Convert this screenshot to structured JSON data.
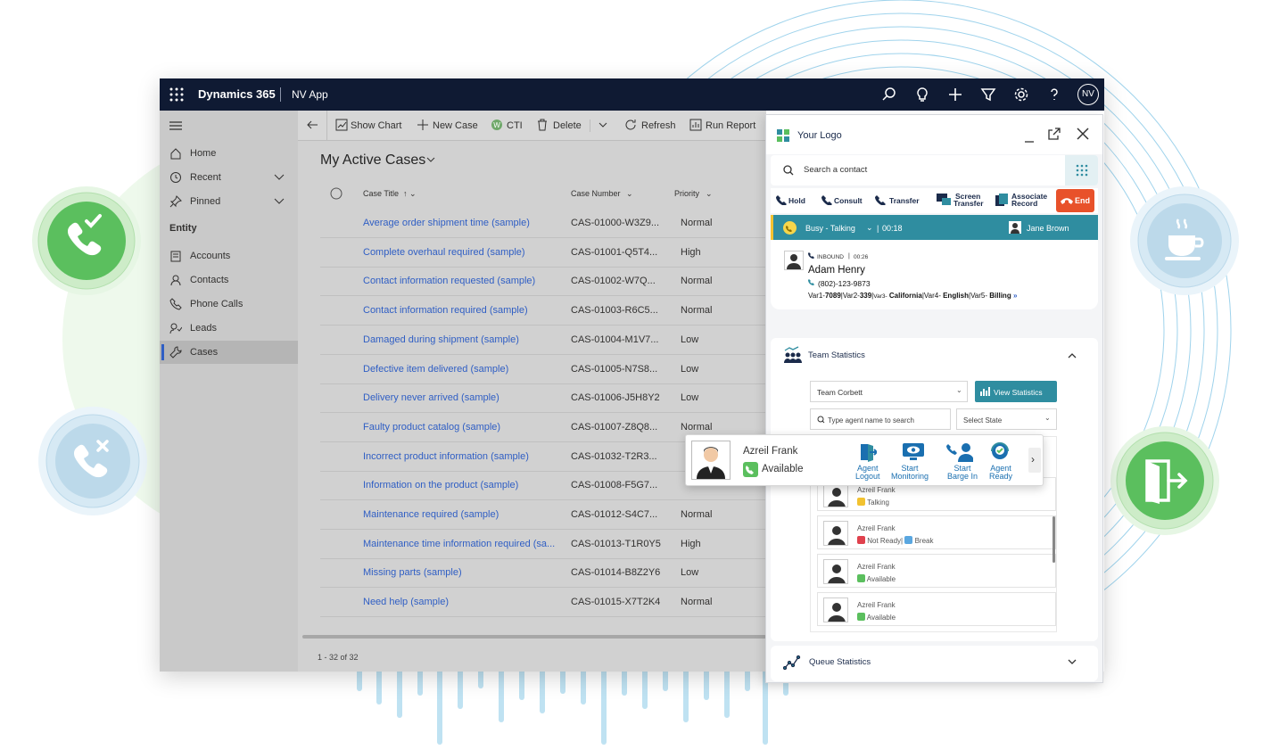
{
  "topbar": {
    "app_name": "Dynamics 365",
    "app_sub": "NV App",
    "avatar": "NV",
    "icons": [
      "search-icon",
      "lightbulb-icon",
      "plus-icon",
      "filter-icon",
      "gear-icon",
      "help-icon"
    ]
  },
  "sidebar": {
    "items": [
      {
        "label": "Home",
        "icon": "home-icon"
      },
      {
        "label": "Recent",
        "icon": "clock-icon"
      },
      {
        "label": "Pinned",
        "icon": "pin-icon"
      }
    ],
    "section": "Entity",
    "entities": [
      {
        "label": "Accounts",
        "icon": "accounts-icon"
      },
      {
        "label": "Contacts",
        "icon": "contact-icon"
      },
      {
        "label": "Phone Calls",
        "icon": "phone-icon"
      },
      {
        "label": "Leads",
        "icon": "leads-icon"
      },
      {
        "label": "Cases",
        "icon": "wrench-icon"
      }
    ]
  },
  "commands": {
    "show_chart": "Show Chart",
    "new_case": "New Case",
    "cti": "CTI",
    "delete": "Delete",
    "refresh": "Refresh",
    "run_report": "Run Report"
  },
  "view": {
    "title": "My Active Cases",
    "col_title": "Case Title",
    "col_number": "Case Number",
    "col_priority": "Priority",
    "footer": "1 - 32 of 32"
  },
  "cases": [
    {
      "title": "Average order shipment time (sample)",
      "number": "CAS-01000-W3Z9...",
      "priority": "Normal"
    },
    {
      "title": "Complete overhaul required (sample)",
      "number": "CAS-01001-Q5T4...",
      "priority": "High"
    },
    {
      "title": "Contact information requested (sample)",
      "number": "CAS-01002-W7Q...",
      "priority": "Normal"
    },
    {
      "title": "Contact information required (sample)",
      "number": "CAS-01003-R6C5...",
      "priority": "Normal"
    },
    {
      "title": "Damaged during shipment (sample)",
      "number": "CAS-01004-M1V7...",
      "priority": "Low"
    },
    {
      "title": "Defective item delivered (sample)",
      "number": "CAS-01005-N7S8...",
      "priority": "Low"
    },
    {
      "title": "Delivery never arrived (sample)",
      "number": "CAS-01006-J5H8Y2",
      "priority": "Low"
    },
    {
      "title": "Faulty product catalog (sample)",
      "number": "CAS-01007-Z8Q8...",
      "priority": "Normal"
    },
    {
      "title": "Incorrect product information (sample)",
      "number": "CAS-01032-T2R3...",
      "priority": ""
    },
    {
      "title": "Information on the product (sample)",
      "number": "CAS-01008-F5G7...",
      "priority": ""
    },
    {
      "title": "Maintenance required (sample)",
      "number": "CAS-01012-S4C7...",
      "priority": "Normal"
    },
    {
      "title": "Maintenance time information required (sa...",
      "number": "CAS-01013-T1R0Y5",
      "priority": "High"
    },
    {
      "title": "Missing parts (sample)",
      "number": "CAS-01014-B8Z2Y6",
      "priority": "Low"
    },
    {
      "title": "Need help (sample)",
      "number": "CAS-01015-X7T2K4",
      "priority": "Normal"
    }
  ],
  "cti": {
    "logo": "Your Logo",
    "search_placeholder": "Search a contact",
    "actions": {
      "hold": "Hold",
      "consult": "Consult",
      "transfer": "Transfer",
      "screen1": "Screen",
      "screen2": "Transfer",
      "assoc1": "Associate",
      "assoc2": "Record",
      "end": "End"
    },
    "status": {
      "state": "Busy - Talking",
      "timer": "00:18",
      "agent": "Jane Brown"
    },
    "call": {
      "direction": "INBOUND",
      "duration": "00:26",
      "name": "Adam Henry",
      "phone": "(802)-123-9873",
      "vars": [
        {
          "k": "Var1-",
          "v": "7089"
        },
        {
          "k": "Var2-",
          "v": "339"
        },
        {
          "k": "Var3-",
          "v": "California"
        },
        {
          "k": "Var4-",
          "v": "English"
        },
        {
          "k": "Var5-",
          "v": "Billing"
        }
      ]
    },
    "team": {
      "title": "Team Statistics",
      "team_select": "Team Corbett",
      "view_btn": "View Statistics",
      "agent_search": "Type agent name to search",
      "state_select": "Select State",
      "members": [
        {
          "name": "Azreil Frank",
          "status": "Talking",
          "status_color": "#f2c230"
        },
        {
          "name": "Azreil Frank",
          "status": "Not Ready",
          "extra": "Break",
          "status_color": "#e0414d"
        },
        {
          "name": "Azreil Frank",
          "status": "Available",
          "status_color": "#5bbf5e"
        },
        {
          "name": "Azreil Frank",
          "status": "Available",
          "status_color": "#5bbf5e"
        }
      ]
    },
    "queue": {
      "title": "Queue Statistics"
    }
  },
  "popup": {
    "name": "Azreil Frank",
    "status": "Available",
    "actions": [
      {
        "l1": "Agent",
        "l2": "Logout"
      },
      {
        "l1": "Start",
        "l2": "Monitoring"
      },
      {
        "l1": "Start",
        "l2": "Barge In"
      },
      {
        "l1": "Agent",
        "l2": "Ready"
      }
    ]
  },
  "colors": {
    "topbar": "#0f1a33",
    "link": "#2f5ec4",
    "teal": "#2f8da0",
    "end": "#e8512a",
    "green": "#5bbf5e",
    "blue_icon": "#1a6fb0"
  }
}
